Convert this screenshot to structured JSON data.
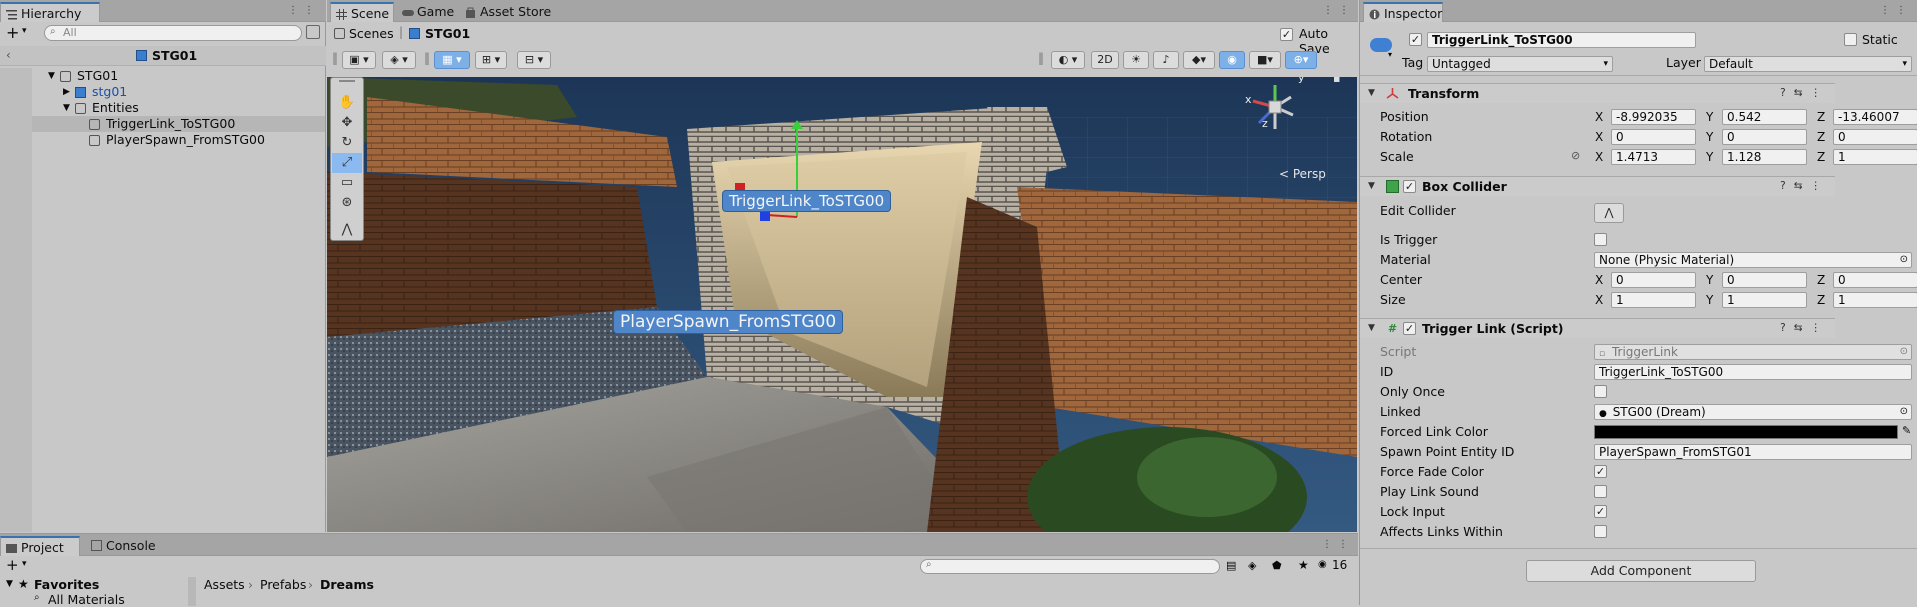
{
  "hierarchy": {
    "tab": "Hierarchy",
    "search_placeholder": "All",
    "scene_title": "STG01",
    "items": [
      {
        "label": "STG01",
        "indent": 0
      },
      {
        "label": "stg01",
        "indent": 1
      },
      {
        "label": "Entities",
        "indent": 1
      },
      {
        "label": "TriggerLink_ToSTG00",
        "indent": 2,
        "selected": true
      },
      {
        "label": "PlayerSpawn_FromSTG00",
        "indent": 2
      }
    ]
  },
  "scene_view": {
    "tabs": [
      "Scene",
      "Game",
      "Asset Store"
    ],
    "breadcrumb_root": "Scenes",
    "breadcrumb_scene": "STG01",
    "auto_save_label": "Auto Save",
    "btn_2d": "2D",
    "persp_label": "< Persp",
    "labels": {
      "trigger": "TriggerLink_ToSTG00",
      "spawn": "PlayerSpawn_FromSTG00"
    }
  },
  "inspector": {
    "tab": "Inspector",
    "object_name": "TriggerLink_ToSTG00",
    "static_label": "Static",
    "tag_label": "Tag",
    "tag_value": "Untagged",
    "layer_label": "Layer",
    "layer_value": "Default",
    "transform": {
      "title": "Transform",
      "position": {
        "label": "Position",
        "x": "-8.992035",
        "y": "0.542",
        "z": "-13.46007"
      },
      "rotation": {
        "label": "Rotation",
        "x": "0",
        "y": "0",
        "z": "0"
      },
      "scale": {
        "label": "Scale",
        "x": "1.4713",
        "y": "1.128",
        "z": "1"
      }
    },
    "box_collider": {
      "title": "Box Collider",
      "edit_collider": "Edit Collider",
      "is_trigger": "Is Trigger",
      "material_label": "Material",
      "material_value": "None (Physic Material)",
      "center": {
        "label": "Center",
        "x": "0",
        "y": "0",
        "z": "0"
      },
      "size": {
        "label": "Size",
        "x": "1",
        "y": "1",
        "z": "1"
      }
    },
    "trigger_link": {
      "title": "Trigger Link (Script)",
      "script_label": "Script",
      "script_value": "TriggerLink",
      "id_label": "ID",
      "id_value": "TriggerLink_ToSTG00",
      "only_once": "Only Once",
      "linked_label": "Linked",
      "linked_value": "STG00 (Dream)",
      "forced_link_color": "Forced Link Color",
      "spawn_point_label": "Spawn Point Entity ID",
      "spawn_point_value": "PlayerSpawn_FromSTG01",
      "force_fade_color": "Force Fade Color",
      "play_link_sound": "Play Link Sound",
      "lock_input": "Lock Input",
      "affects_links_within": "Affects Links Within"
    },
    "add_component": "Add Component"
  },
  "project": {
    "tabs": [
      "Project",
      "Console"
    ],
    "favorites": "Favorites",
    "all_materials": "All Materials",
    "breadcrumb": [
      "Assets",
      "Prefabs",
      "Dreams"
    ],
    "count": "16"
  },
  "axis_labels": {
    "x": "X",
    "y": "Y",
    "z": "Z"
  },
  "colors": {
    "accent": "#3a72b0",
    "selection": "#4f86c9"
  }
}
